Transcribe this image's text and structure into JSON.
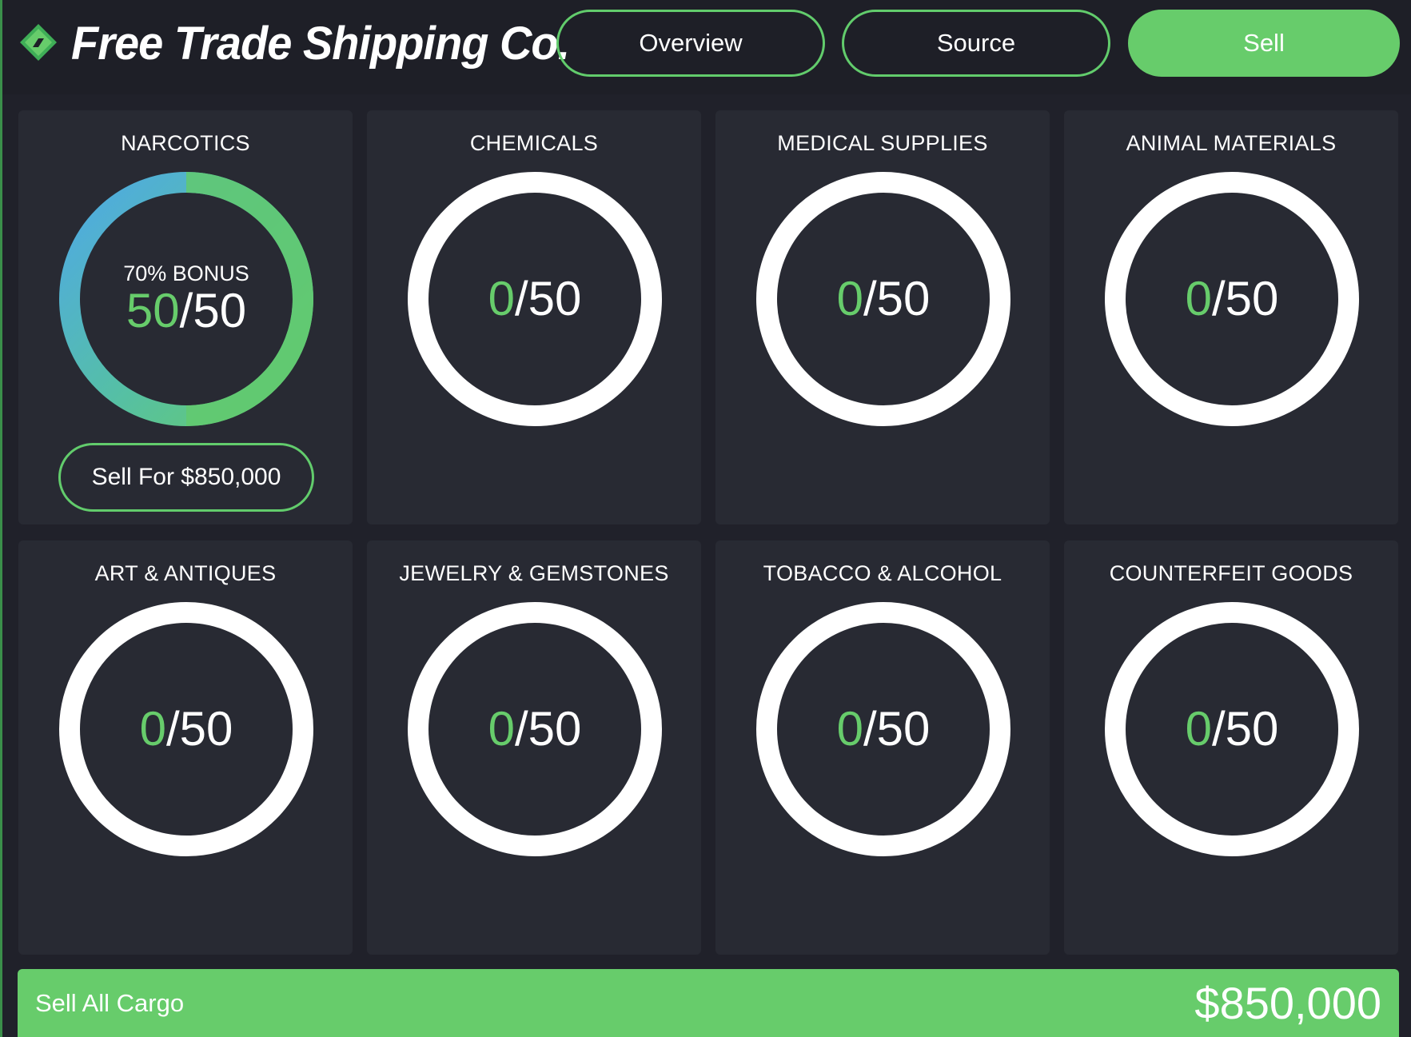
{
  "brand": {
    "name": "Free Trade Shipping Co.",
    "logo_icon": "shipping-diamond-logo",
    "accent_color": "#67cc6b"
  },
  "nav": {
    "tabs": [
      {
        "label": "Overview",
        "active": false
      },
      {
        "label": "Source",
        "active": false
      },
      {
        "label": "Sell",
        "active": true
      }
    ]
  },
  "cargo": [
    {
      "title": "NARCOTICS",
      "current": "50",
      "max": "50",
      "bonus": "70% BONUS",
      "fill_fraction": 1.0,
      "sell_label": "Sell For $850,000"
    },
    {
      "title": "CHEMICALS",
      "current": "0",
      "max": "50",
      "fill_fraction": 0
    },
    {
      "title": "MEDICAL SUPPLIES",
      "current": "0",
      "max": "50",
      "fill_fraction": 0
    },
    {
      "title": "ANIMAL MATERIALS",
      "current": "0",
      "max": "50",
      "fill_fraction": 0
    },
    {
      "title": "ART & ANTIQUES",
      "current": "0",
      "max": "50",
      "fill_fraction": 0
    },
    {
      "title": "JEWELRY & GEMSTONES",
      "current": "0",
      "max": "50",
      "fill_fraction": 0
    },
    {
      "title": "TOBACCO & ALCOHOL",
      "current": "0",
      "max": "50",
      "fill_fraction": 0
    },
    {
      "title": "COUNTERFEIT GOODS",
      "current": "0",
      "max": "50",
      "fill_fraction": 0
    }
  ],
  "count_separator": "/",
  "footer": {
    "label": "Sell All Cargo",
    "total": "$850,000"
  }
}
